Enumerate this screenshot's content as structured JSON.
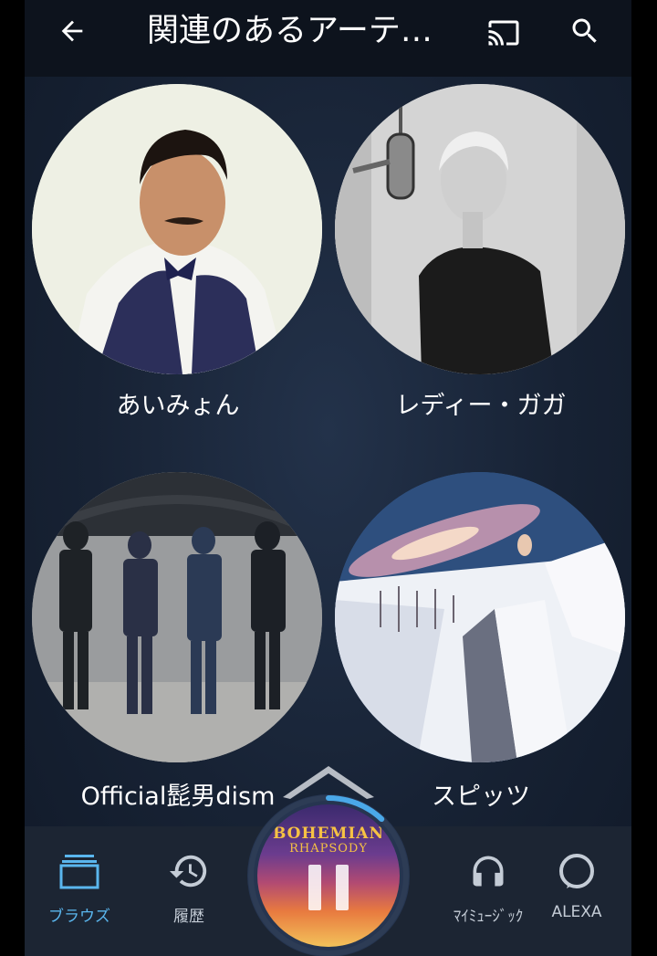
{
  "header": {
    "title": "関連のあるアーテ…"
  },
  "artists": [
    {
      "name": "あいみょん"
    },
    {
      "name": "レディー・ガガ"
    },
    {
      "name": "Official髭男dism"
    },
    {
      "name": "スピッツ"
    }
  ],
  "now_playing": {
    "album_title": "BOHEMIAN",
    "album_subtitle": "RHAPSODY",
    "progress": 0.12
  },
  "bottom_nav": {
    "items": [
      {
        "label": "ブラウズ",
        "icon": "browse-icon",
        "active": true
      },
      {
        "label": "履歴",
        "icon": "history-icon",
        "active": false
      },
      {
        "label": "ﾏｲﾐｭｰｼﾞｯｸ",
        "icon": "headphones-icon",
        "active": false
      },
      {
        "label": "ALEXA",
        "icon": "alexa-icon",
        "active": false
      }
    ]
  },
  "colors": {
    "accent": "#5ab6ee",
    "topbar": "#0d131d",
    "background": "#172234",
    "bottom_nav": "#1c2533"
  }
}
